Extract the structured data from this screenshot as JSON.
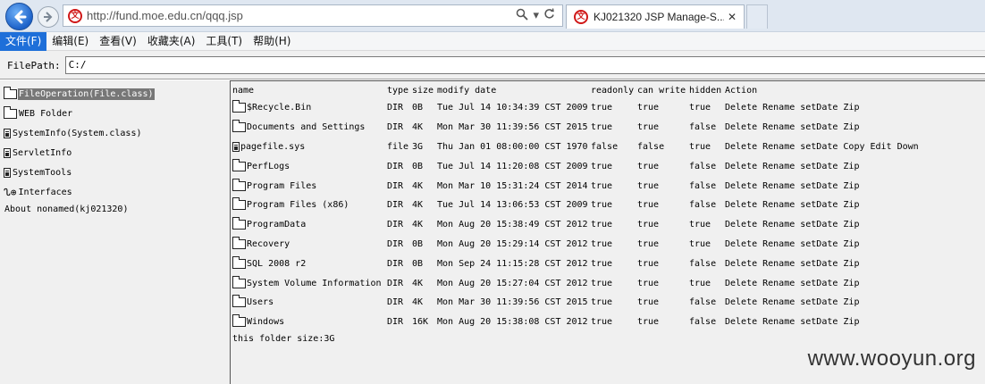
{
  "browser": {
    "url": "http://fund.moe.edu.cn/qqq.jsp",
    "tab_title": "KJ021320 JSP Manage-S...",
    "tab_close": "✕"
  },
  "menu": {
    "items": [
      {
        "label": "文件(F)",
        "active": true
      },
      {
        "label": "编辑(E)"
      },
      {
        "label": "查看(V)"
      },
      {
        "label": "收藏夹(A)"
      },
      {
        "label": "工具(T)"
      },
      {
        "label": "帮助(H)"
      }
    ]
  },
  "filepath": {
    "label": "FilePath:",
    "value": "C:/"
  },
  "sidebar": {
    "items": [
      {
        "label": "FileOperation(File.class)",
        "icon": "folder-icon",
        "selected": true
      },
      {
        "label": "WEB Folder",
        "icon": "folder-icon"
      },
      {
        "label": "SystemInfo(System.class)",
        "icon": "doc-icon"
      },
      {
        "label": "ServletInfo",
        "icon": "doc-icon"
      },
      {
        "label": "SystemTools",
        "icon": "doc-icon"
      },
      {
        "label": "Interfaces",
        "icon": "net-icon"
      },
      {
        "label": "About nonamed(kj021320)",
        "icon": ""
      }
    ]
  },
  "table": {
    "headers": {
      "name": "name",
      "type": "type",
      "size": "size",
      "modify": "modify date",
      "readonly": "readonly",
      "canwrite": "can write",
      "hidden": "hidden",
      "action": "Action"
    },
    "rows": [
      {
        "name": "$Recycle.Bin",
        "icon": "folder",
        "type": "DIR",
        "size": "0B",
        "modify": "Tue Jul 14 10:34:39 CST 2009",
        "readonly": "true",
        "canwrite": "true",
        "hidden": "true",
        "actions": [
          "Delete",
          "Rename",
          "setDate",
          "Zip"
        ]
      },
      {
        "name": "Documents and Settings",
        "icon": "folder",
        "type": "DIR",
        "size": "4K",
        "modify": "Mon Mar 30 11:39:56 CST 2015",
        "readonly": "true",
        "canwrite": "true",
        "hidden": "false",
        "actions": [
          "Delete",
          "Rename",
          "setDate",
          "Zip"
        ]
      },
      {
        "name": "pagefile.sys",
        "icon": "file",
        "type": "file",
        "size": "3G",
        "modify": "Thu Jan 01 08:00:00 CST 1970",
        "readonly": "false",
        "canwrite": "false",
        "hidden": "true",
        "actions": [
          "Delete",
          "Rename",
          "setDate",
          "Copy",
          "Edit",
          "Down"
        ]
      },
      {
        "name": "PerfLogs",
        "icon": "folder",
        "type": "DIR",
        "size": "0B",
        "modify": "Tue Jul 14 11:20:08 CST 2009",
        "readonly": "true",
        "canwrite": "true",
        "hidden": "false",
        "actions": [
          "Delete",
          "Rename",
          "setDate",
          "Zip"
        ]
      },
      {
        "name": "Program Files",
        "icon": "folder",
        "type": "DIR",
        "size": "4K",
        "modify": "Mon Mar 10 15:31:24 CST 2014",
        "readonly": "true",
        "canwrite": "true",
        "hidden": "false",
        "actions": [
          "Delete",
          "Rename",
          "setDate",
          "Zip"
        ]
      },
      {
        "name": "Program Files (x86)",
        "icon": "folder",
        "type": "DIR",
        "size": "4K",
        "modify": "Tue Jul 14 13:06:53 CST 2009",
        "readonly": "true",
        "canwrite": "true",
        "hidden": "false",
        "actions": [
          "Delete",
          "Rename",
          "setDate",
          "Zip"
        ]
      },
      {
        "name": "ProgramData",
        "icon": "folder",
        "type": "DIR",
        "size": "4K",
        "modify": "Mon Aug 20 15:38:49 CST 2012",
        "readonly": "true",
        "canwrite": "true",
        "hidden": "true",
        "actions": [
          "Delete",
          "Rename",
          "setDate",
          "Zip"
        ]
      },
      {
        "name": "Recovery",
        "icon": "folder",
        "type": "DIR",
        "size": "0B",
        "modify": "Mon Aug 20 15:29:14 CST 2012",
        "readonly": "true",
        "canwrite": "true",
        "hidden": "true",
        "actions": [
          "Delete",
          "Rename",
          "setDate",
          "Zip"
        ]
      },
      {
        "name": "SQL 2008 r2",
        "icon": "folder",
        "type": "DIR",
        "size": "0B",
        "modify": "Mon Sep 24 11:15:28 CST 2012",
        "readonly": "true",
        "canwrite": "true",
        "hidden": "false",
        "actions": [
          "Delete",
          "Rename",
          "setDate",
          "Zip"
        ]
      },
      {
        "name": "System Volume Information",
        "icon": "folder",
        "type": "DIR",
        "size": "4K",
        "modify": "Mon Aug 20 15:27:04 CST 2012",
        "readonly": "true",
        "canwrite": "true",
        "hidden": "true",
        "actions": [
          "Delete",
          "Rename",
          "setDate",
          "Zip"
        ]
      },
      {
        "name": "Users",
        "icon": "folder",
        "type": "DIR",
        "size": "4K",
        "modify": "Mon Mar 30 11:39:56 CST 2015",
        "readonly": "true",
        "canwrite": "true",
        "hidden": "false",
        "actions": [
          "Delete",
          "Rename",
          "setDate",
          "Zip"
        ]
      },
      {
        "name": "Windows",
        "icon": "folder",
        "type": "DIR",
        "size": "16K",
        "modify": "Mon Aug 20 15:38:08 CST 2012",
        "readonly": "true",
        "canwrite": "true",
        "hidden": "false",
        "actions": [
          "Delete",
          "Rename",
          "setDate",
          "Zip"
        ]
      }
    ],
    "folder_size": "this folder size:3G"
  },
  "watermark": "www.wooyun.org"
}
